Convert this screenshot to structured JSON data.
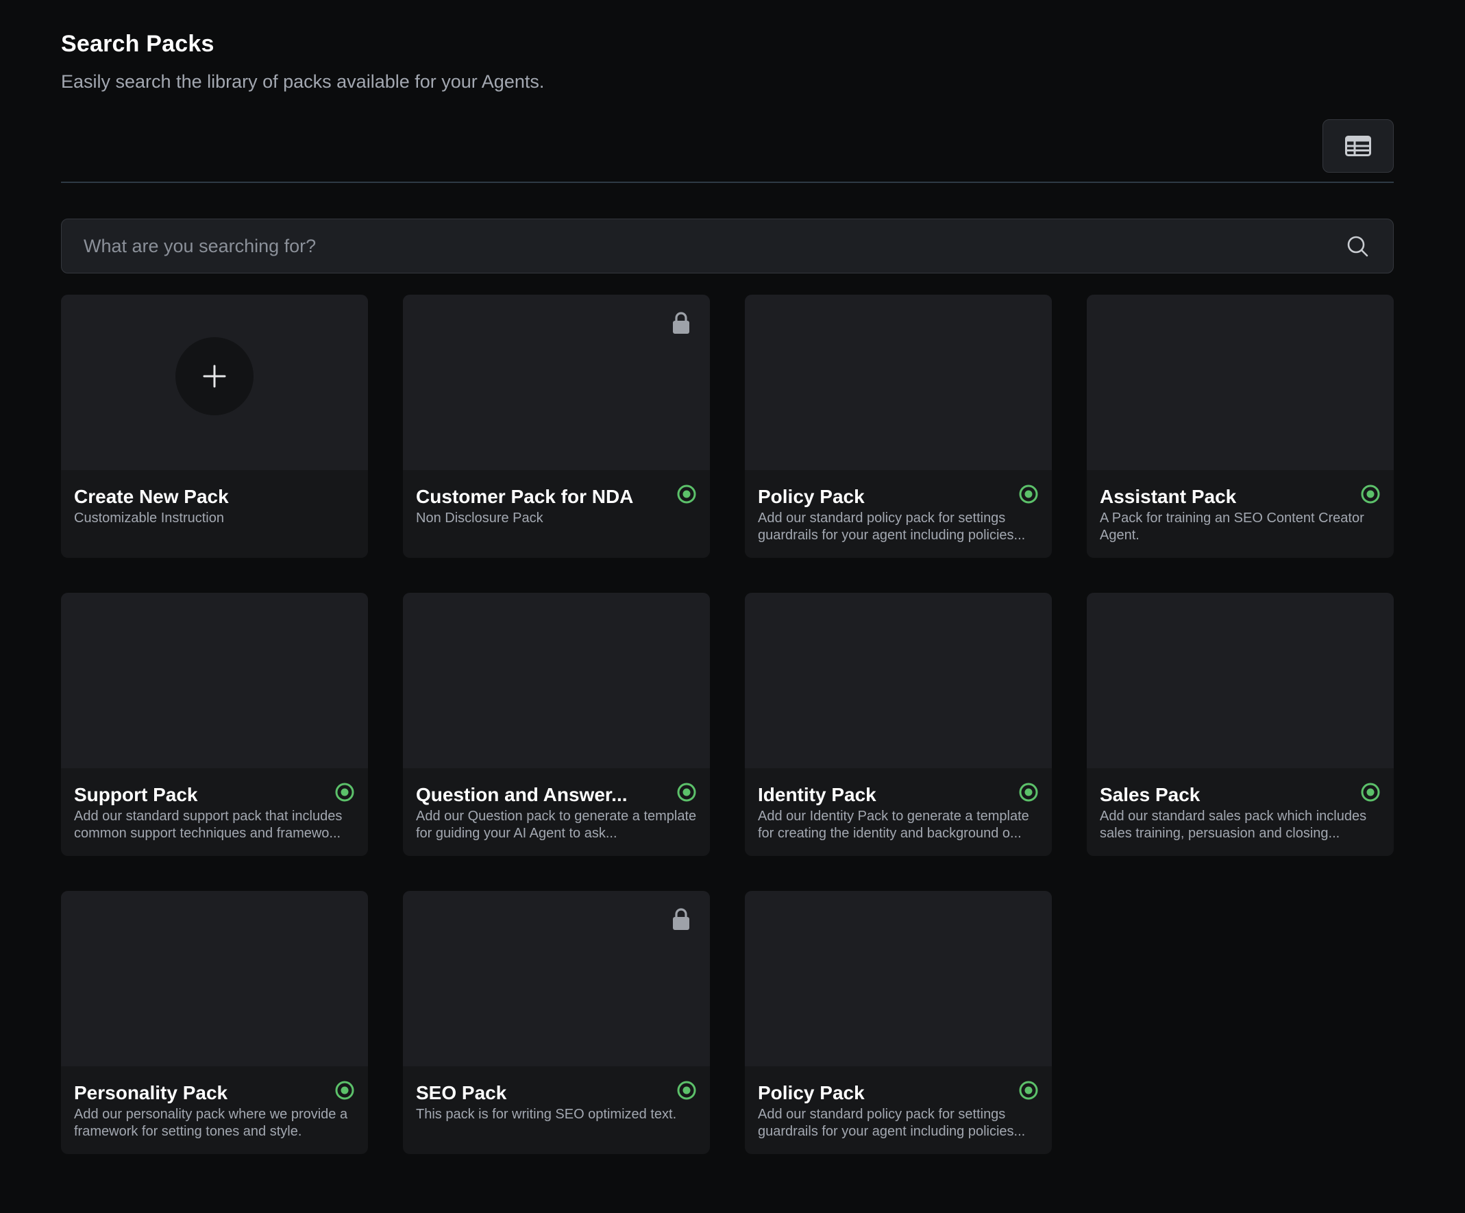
{
  "header": {
    "title": "Search Packs",
    "subtitle": "Easily search the library of packs available for your Agents."
  },
  "toolbar": {
    "view_toggle_icon": "table-view-icon"
  },
  "search": {
    "placeholder": "What are you searching for?",
    "value": "",
    "icon": "search-icon"
  },
  "colors": {
    "background": "#0b0c0d",
    "card": "#161719",
    "card_thumb": "#1d1e22",
    "active_status": "#5cc16a",
    "muted_text": "#a3a8b1"
  },
  "create_card": {
    "title": "Create New Pack",
    "description": "Customizable Instruction",
    "icon": "plus-icon"
  },
  "packs": [
    {
      "title": "Customer Pack for NDA",
      "description": "Non Disclosure Pack",
      "locked": true,
      "active": true
    },
    {
      "title": "Policy Pack",
      "description": "Add our standard policy pack for settings guardrails for your agent including policies...",
      "locked": false,
      "active": true
    },
    {
      "title": "Assistant Pack",
      "description": "A Pack for training an SEO Content Creator Agent.",
      "locked": false,
      "active": true
    },
    {
      "title": "Support Pack",
      "description": "Add our standard support pack that includes common support techniques and framewo...",
      "locked": false,
      "active": true
    },
    {
      "title": "Question and Answer...",
      "description": "Add our Question pack to generate a template for guiding your AI Agent to ask...",
      "locked": false,
      "active": true
    },
    {
      "title": "Identity Pack",
      "description": "Add our Identity Pack to generate a template for creating the identity and background o...",
      "locked": false,
      "active": true
    },
    {
      "title": "Sales Pack",
      "description": "Add our standard sales pack which includes sales training, persuasion and closing...",
      "locked": false,
      "active": true
    },
    {
      "title": "Personality Pack",
      "description": "Add our personality pack where we provide a framework for setting tones and style.",
      "locked": false,
      "active": true
    },
    {
      "title": "SEO Pack",
      "description": "This pack is for writing SEO optimized text.",
      "locked": true,
      "active": true
    },
    {
      "title": "Policy Pack",
      "description": "Add our standard policy pack for settings guardrails for your agent including policies...",
      "locked": false,
      "active": true
    }
  ]
}
